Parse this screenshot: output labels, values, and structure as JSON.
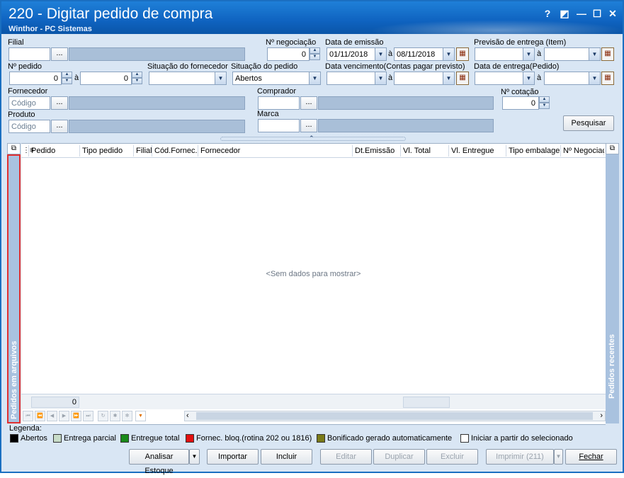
{
  "window": {
    "title": "220 - Digitar pedido de compra",
    "subtitle": "Winthor - PC Sistemas",
    "controls": [
      "?",
      "◩",
      "—",
      "☐",
      "✕"
    ]
  },
  "filters": {
    "filial_label": "Filial",
    "negociacao_label": "Nº negociação",
    "negociacao_value": "0",
    "emissao_label": "Data de emissão",
    "emissao_from": "01/11/2018",
    "emissao_to": "08/11/2018",
    "a_label": "à",
    "previsao_label": "Previsão  de entrega (Item)",
    "pedido_label": "Nº pedido",
    "pedido_from": "0",
    "pedido_to": "0",
    "sit_fornecedor_label": "Situação do fornecedor",
    "sit_pedido_label": "Situação do pedido",
    "sit_pedido_value": "Abertos",
    "vencimento_label": "Data vencimento(Contas pagar previsto)",
    "entrega_label": "Data de entrega(Pedido)",
    "fornecedor_label": "Fornecedor",
    "codigo_placeholder": "Código",
    "comprador_label": "Comprador",
    "cotacao_label": "Nº cotação",
    "cotacao_value": "0",
    "produto_label": "Produto",
    "marca_label": "Marca",
    "pesquisar_label": "Pesquisar",
    "dots": "..."
  },
  "grid": {
    "columns": [
      "Pedido",
      "Tipo pedido",
      "Filial",
      "Cód.Fornec.",
      "Fornecedor",
      "Dt.Emissão",
      "Vl. Total",
      "Vl. Entregue",
      "Tipo embalagem",
      "Nº Negociação"
    ],
    "empty_text": "<Sem dados para mostrar>",
    "footer_count": "0",
    "left_panel": "Pedidos em arquivos",
    "right_panel": "Pedidos recentes"
  },
  "legend": {
    "title": "Legenda:",
    "items": [
      {
        "label": "Abertos",
        "color": "#000000"
      },
      {
        "label": "Entrega parcial",
        "color": "#c8dcc8"
      },
      {
        "label": "Entregue total",
        "color": "#1a8a1a"
      },
      {
        "label": "Fornec. bloq.(rotina 202 ou 1816)",
        "color": "#e21010"
      },
      {
        "label": "Bonificado gerado automaticamente",
        "color": "#7a7a18"
      },
      {
        "label": "Iniciar a partir do selecionado",
        "color": "#ffffff"
      }
    ]
  },
  "buttons": {
    "analisar": "Analisar Estoque",
    "importar": "Importar",
    "incluir": "Incluir",
    "editar": "Editar",
    "duplicar": "Duplicar",
    "excluir": "Excluir",
    "imprimir": "Imprimir (211)",
    "fechar": "Fechar"
  }
}
